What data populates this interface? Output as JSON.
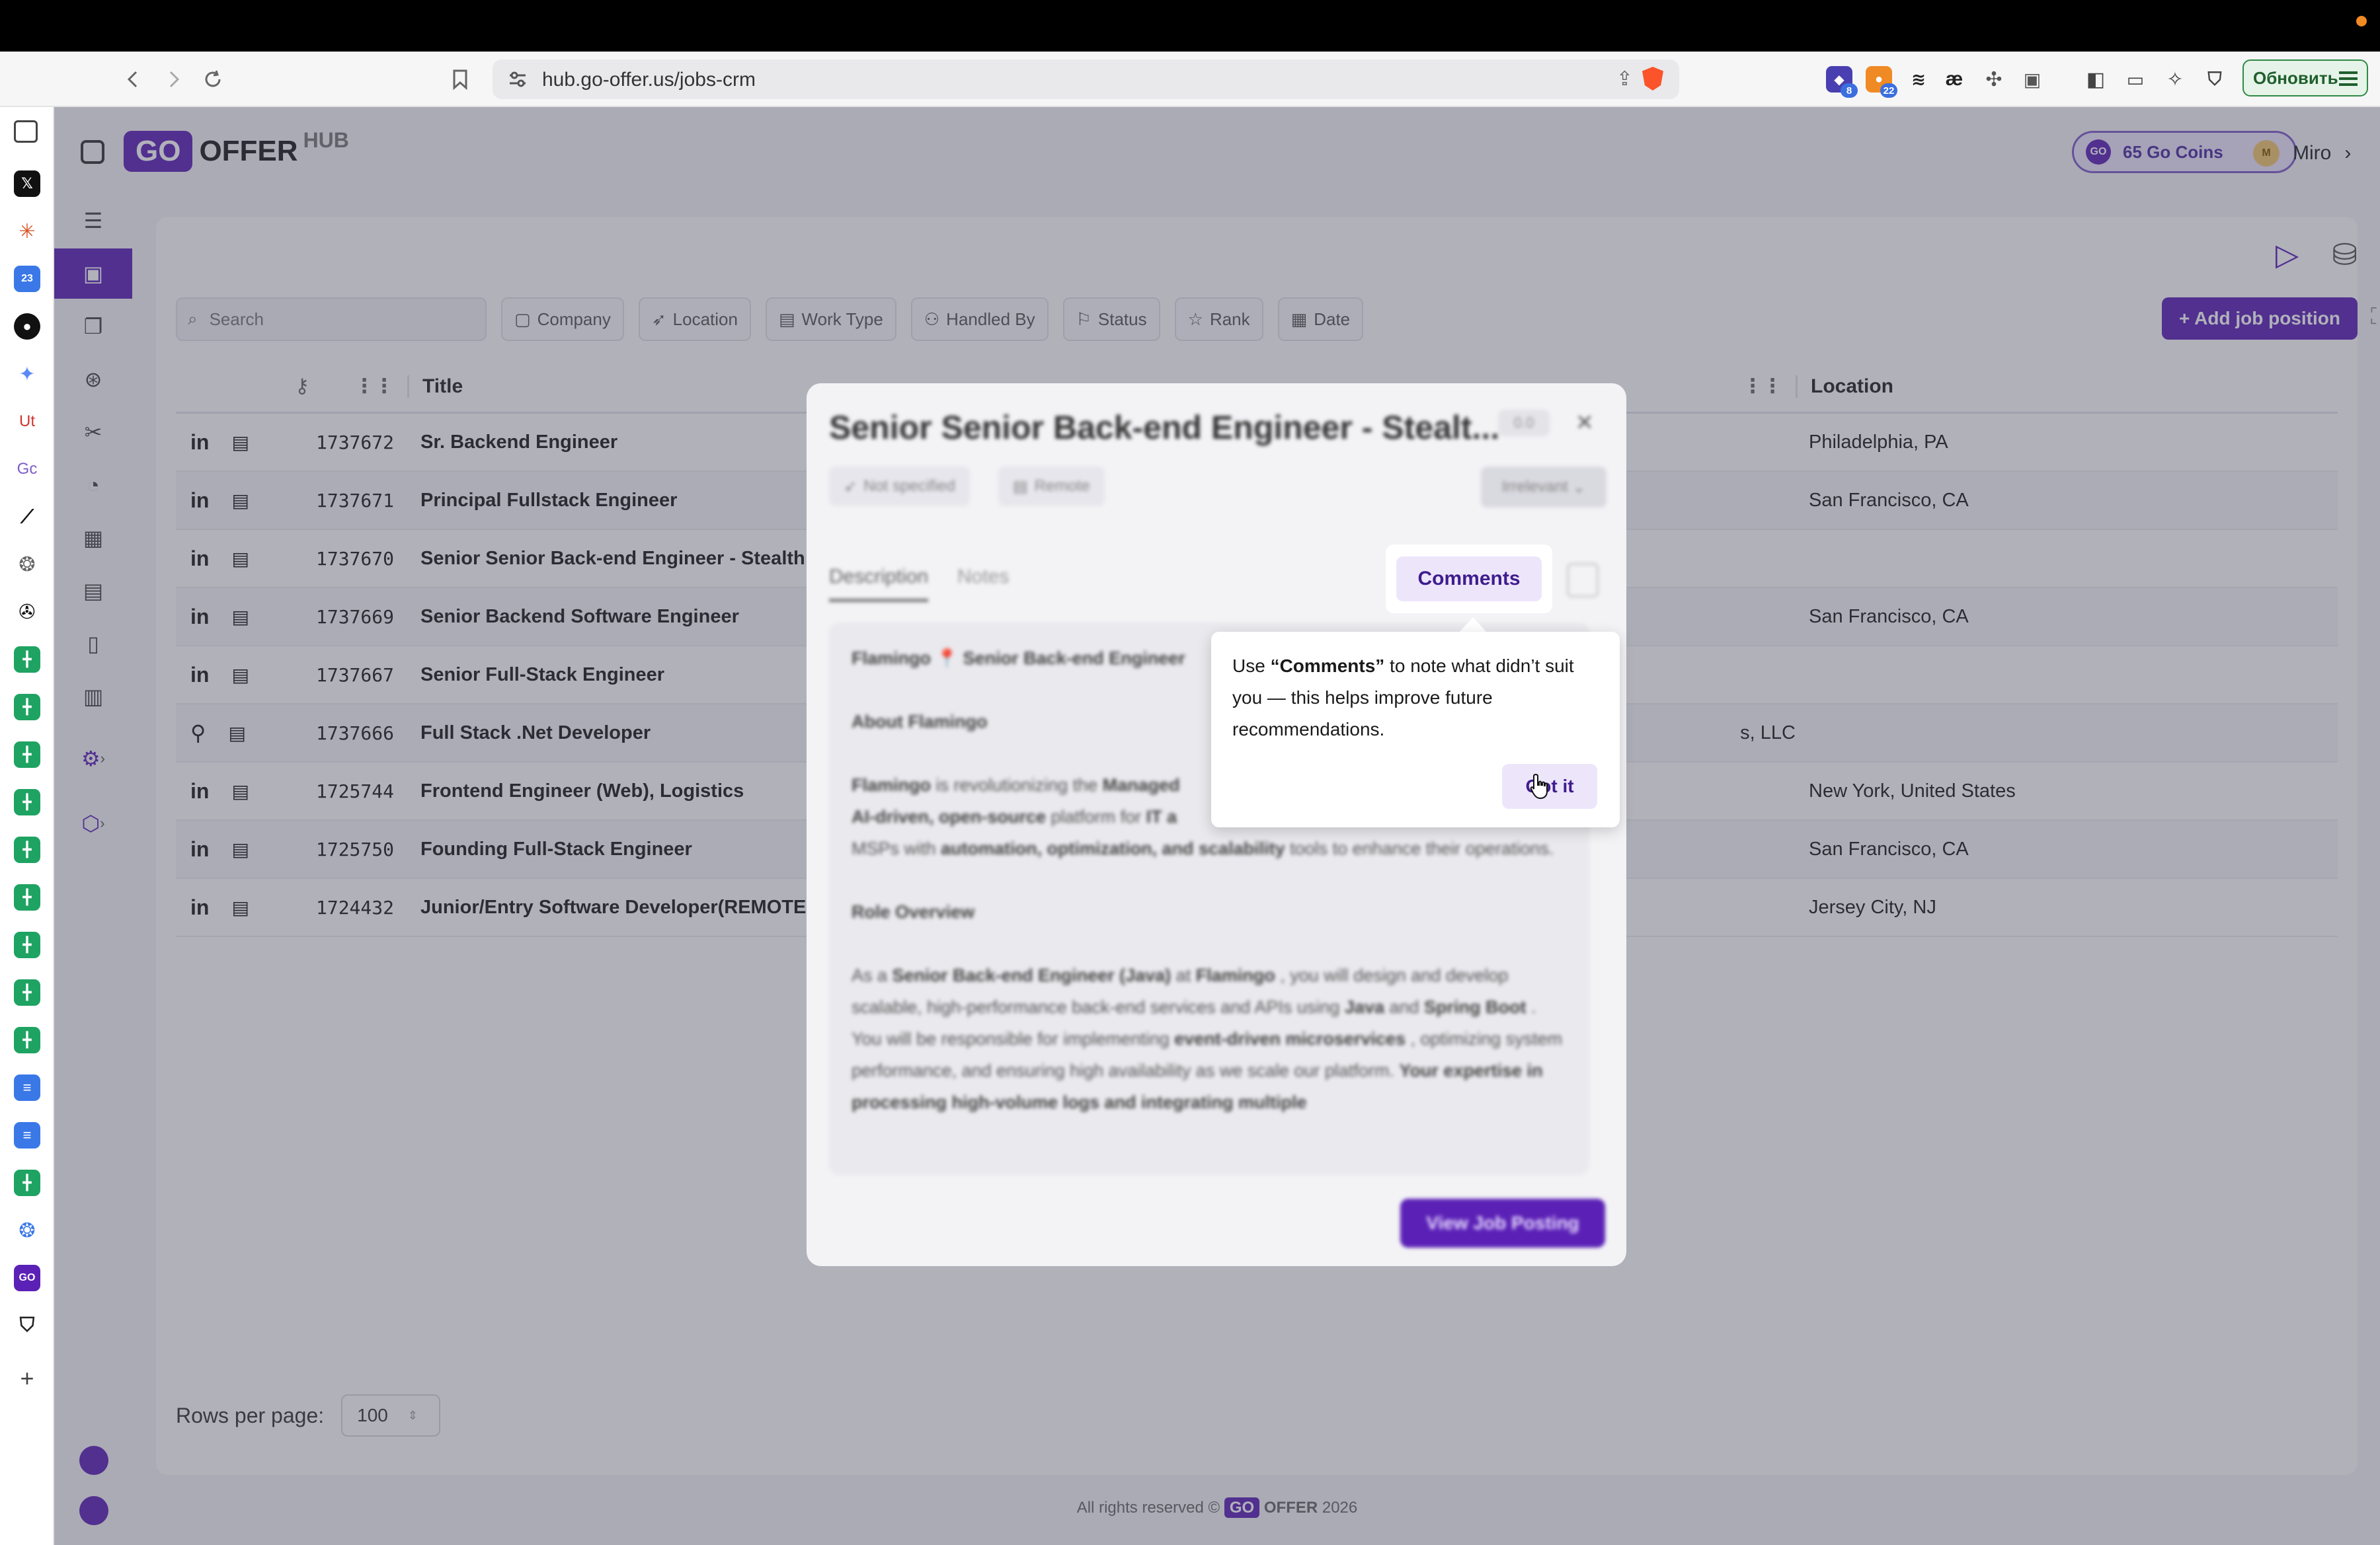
{
  "browser": {
    "url": "hub.go-offer.us/jobs-crm",
    "update_label": "Обновить",
    "ext_badges": [
      "8",
      "22"
    ],
    "ext_text": "æ"
  },
  "tabs": {
    "ut_label": "Ut",
    "gc_label": "Gc"
  },
  "app": {
    "logo": {
      "go": "GO",
      "offer": "OFFER",
      "hub": "HUB"
    },
    "coins_label": "65 Go Coins",
    "user": {
      "initial": "M",
      "name": "Miro"
    },
    "search_placeholder": "Search",
    "filters": [
      "Company",
      "Location",
      "Work Type",
      "Handled By",
      "Status",
      "Rank",
      "Date"
    ],
    "add_job_label": "+ Add job position",
    "table": {
      "headers": {
        "title": "Title",
        "location": "Location"
      },
      "rows": [
        {
          "source": "in",
          "id": "1737672",
          "title": "Sr. Backend Engineer",
          "company": "",
          "location": "Philadelphia, PA"
        },
        {
          "source": "in",
          "id": "1737671",
          "title": "Principal Fullstack Engineer",
          "company": "",
          "location": "San Francisco, CA"
        },
        {
          "source": "in",
          "id": "1737670",
          "title": "Senior Senior Back-end Engineer - Stealth",
          "company": "",
          "location": ""
        },
        {
          "source": "in",
          "id": "1737669",
          "title": "Senior Backend Software Engineer",
          "company": "",
          "location": "San Francisco, CA"
        },
        {
          "source": "in",
          "id": "1737667",
          "title": "Senior Full-Stack Engineer",
          "company": "",
          "location": ""
        },
        {
          "source": "other",
          "id": "1737666",
          "title": "Full Stack .Net Developer",
          "company": "s, LLC",
          "location": ""
        },
        {
          "source": "in",
          "id": "1725744",
          "title": "Frontend Engineer (Web), Logistics",
          "company": "",
          "location": "New York, United States"
        },
        {
          "source": "in",
          "id": "1725750",
          "title": "Founding Full-Stack Engineer",
          "company": "",
          "location": "San Francisco, CA"
        },
        {
          "source": "in",
          "id": "1724432",
          "title": "Junior/Entry Software Developer(REMOTE",
          "company": "",
          "location": "Jersey City, NJ"
        }
      ]
    },
    "rows_per_page_label": "Rows per page:",
    "rows_per_page_value": "100",
    "footer": {
      "prefix": "All rights reserved ©",
      "go": "GO",
      "offer": "OFFER",
      "year": "2026"
    }
  },
  "modal": {
    "title": "Senior Senior Back-end Engineer - Stealt...",
    "score": "0.0",
    "tag_location": "Not specified",
    "tag_worktype": "Remote",
    "rank": "Irrelevant",
    "tab_description": "Description",
    "tab_notes": "Notes",
    "body": {
      "line1_company": "Flamingo",
      "line1_sep": "📍",
      "line1_role": "Senior Back-end Engineer",
      "about_heading": "About Flamingo",
      "about_a": "Flamingo",
      "about_b": " is revolutionizing the ",
      "about_c": "Managed",
      "about_d": "AI-driven, open-source",
      "about_e": " platform for ",
      "about_f": "IT a",
      "about_g": "MSPs with ",
      "about_h": "automation, optimization, and scalability",
      "about_i": " tools to enhance their operations.",
      "role_heading": "Role Overview",
      "role_a": "As a ",
      "role_b": "Senior Back-end Engineer (Java)",
      "role_c": " at ",
      "role_d": "Flamingo",
      "role_e": " , you will design and develop scalable, high-performance back-end services and APIs using ",
      "role_f": "Java",
      "role_g": " and ",
      "role_h": "Spring Boot",
      "role_i": " . You will be responsible for implementing ",
      "role_j": "event-driven microservices",
      "role_k": " , optimizing system performance, and ensuring high availability as we scale our platform. ",
      "role_l": "Your expertise in processing high-volume logs and integrating multiple"
    },
    "view_button": "View Job Posting"
  },
  "onboarding": {
    "comments_button": "Comments",
    "tip_prefix": "Use ",
    "tip_bold": "“Comments”",
    "tip_suffix": " to note what didn’t suit you — this helps improve future recommendations.",
    "got_it": "Got it"
  },
  "colors": {
    "brand": "#5b21b6",
    "brand_soft": "#ede6fb"
  }
}
